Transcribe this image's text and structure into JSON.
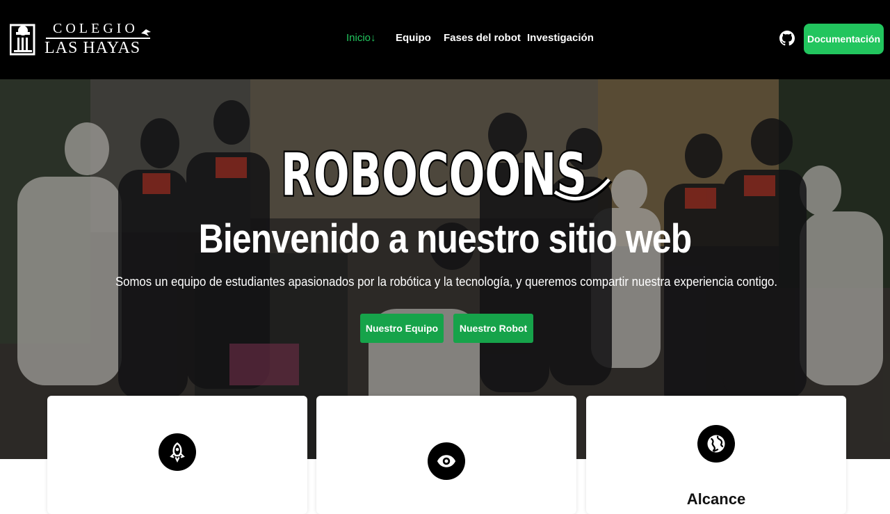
{
  "brand": {
    "line1": "COLEGIO",
    "line2": "LAS HAYAS"
  },
  "nav": {
    "items": [
      {
        "label": "Inicio",
        "suffix": "↓",
        "active": true
      },
      {
        "label": "Equipo",
        "active": false
      },
      {
        "label": "Fases del robot",
        "active": false
      },
      {
        "label": "Investigación",
        "active": false
      }
    ],
    "github_icon": "github-icon",
    "doc_button": "Documentación"
  },
  "hero": {
    "logo_text": "ROBOCOONS",
    "title": "Bienvenido a nuestro sitio web",
    "subtitle": "Somos un equipo de estudiantes apasionados por la robótica y la tecnología, y queremos compartir nuestra experiencia contigo.",
    "buttons": [
      "Nuestro Equipo",
      "Nuestro Robot"
    ]
  },
  "cards": [
    {
      "icon": "rocket-icon",
      "title": ""
    },
    {
      "icon": "eye-icon",
      "title": ""
    },
    {
      "icon": "globe-icon",
      "title": "Alcance"
    }
  ],
  "colors": {
    "accent": "#22c55e",
    "button": "#16a34a",
    "navbar": "#000000"
  }
}
